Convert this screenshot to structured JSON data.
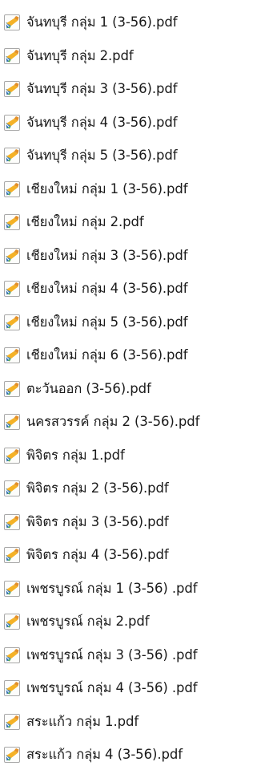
{
  "files": [
    {
      "name": "จันทบุรี กลุ่ม 1 (3-56).pdf",
      "icon": "pdf-file-icon"
    },
    {
      "name": "จันทบุรี กลุ่ม 2.pdf",
      "icon": "pdf-file-icon"
    },
    {
      "name": "จันทบุรี กลุ่ม 3 (3-56).pdf",
      "icon": "pdf-file-icon"
    },
    {
      "name": "จันทบุรี กลุ่ม 4 (3-56).pdf",
      "icon": "pdf-file-icon"
    },
    {
      "name": "จันทบุรี กลุ่ม 5 (3-56).pdf",
      "icon": "pdf-file-icon"
    },
    {
      "name": "เชียงใหม่ กลุ่ม 1 (3-56).pdf",
      "icon": "pdf-file-icon"
    },
    {
      "name": "เชียงใหม่ กลุ่ม 2.pdf",
      "icon": "pdf-file-icon"
    },
    {
      "name": "เชียงใหม่ กลุ่ม 3 (3-56).pdf",
      "icon": "pdf-file-icon"
    },
    {
      "name": "เชียงใหม่ กลุ่ม 4 (3-56).pdf",
      "icon": "pdf-file-icon"
    },
    {
      "name": "เชียงใหม่ กลุ่ม 5 (3-56).pdf",
      "icon": "pdf-file-icon"
    },
    {
      "name": "เชียงใหม่ กลุ่ม 6 (3-56).pdf",
      "icon": "pdf-file-icon"
    },
    {
      "name": "ตะวันออก (3-56).pdf",
      "icon": "pdf-file-icon"
    },
    {
      "name": "นครสวรรค์ กลุ่ม 2 (3-56).pdf",
      "icon": "pdf-file-icon"
    },
    {
      "name": "พิจิตร กลุ่ม 1.pdf",
      "icon": "pdf-file-icon"
    },
    {
      "name": "พิจิตร กลุ่ม 2 (3-56).pdf",
      "icon": "pdf-file-icon"
    },
    {
      "name": "พิจิตร กลุ่ม 3 (3-56).pdf",
      "icon": "pdf-file-icon"
    },
    {
      "name": "พิจิตร กลุ่ม 4 (3-56).pdf",
      "icon": "pdf-file-icon"
    },
    {
      "name": "เพชรบูรณ์ กลุ่ม 1 (3-56) .pdf",
      "icon": "pdf-file-icon"
    },
    {
      "name": "เพชรบูรณ์ กลุ่ม 2.pdf",
      "icon": "pdf-file-icon"
    },
    {
      "name": "เพชรบูรณ์ กลุ่ม 3 (3-56) .pdf",
      "icon": "pdf-file-icon"
    },
    {
      "name": "เพชรบูรณ์ กลุ่ม 4 (3-56) .pdf",
      "icon": "pdf-file-icon"
    },
    {
      "name": "สระแก้ว กลุ่ม 1.pdf",
      "icon": "pdf-file-icon"
    },
    {
      "name": "สระแก้ว กลุ่ม 4 (3-56).pdf",
      "icon": "pdf-file-icon"
    }
  ]
}
